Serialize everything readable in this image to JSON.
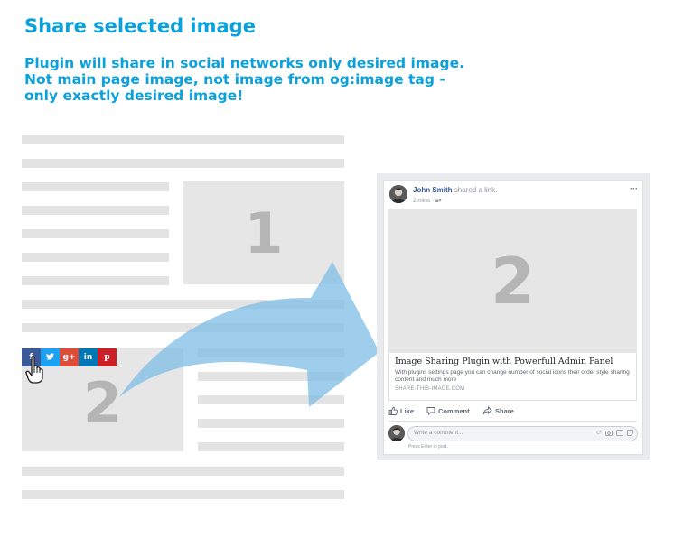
{
  "header": {
    "title": "Share selected image",
    "description": [
      "Plugin will share in social networks only desired image.",
      "Not main page image, not image from og:image tag -",
      "only exactly desired image!"
    ]
  },
  "mock_page": {
    "image1_label": "1",
    "image2_label": "2"
  },
  "social_buttons": [
    {
      "name": "facebook",
      "glyph": "f",
      "color": "#3b5998"
    },
    {
      "name": "twitter",
      "glyph": "t",
      "color": "#1da1f2"
    },
    {
      "name": "google-plus",
      "glyph": "g+",
      "color": "#dd4b39"
    },
    {
      "name": "linkedin",
      "glyph": "in",
      "color": "#0077b5"
    },
    {
      "name": "pinterest",
      "glyph": "p",
      "color": "#cb2027"
    }
  ],
  "fb_post": {
    "author": "John Smith",
    "action": " shared a link.",
    "time": "2 mins",
    "menu_dots": "···",
    "image_label": "2",
    "link_title": "Image Sharing Plugin with Powerfull Admin Panel",
    "link_description": "With plugins settings page you can change number of social icons their order style sharing content and much more",
    "link_domain": "SHARE-THIS-IMAGE.COM",
    "like_label": "Like",
    "comment_label": "Comment",
    "share_label": "Share",
    "comment_placeholder": "Write a comment...",
    "enter_hint": "Press Enter to post."
  },
  "colors": {
    "accent": "#0aa1dc",
    "arrow": "#7fbde6",
    "placeholder": "#e6e6e6"
  }
}
